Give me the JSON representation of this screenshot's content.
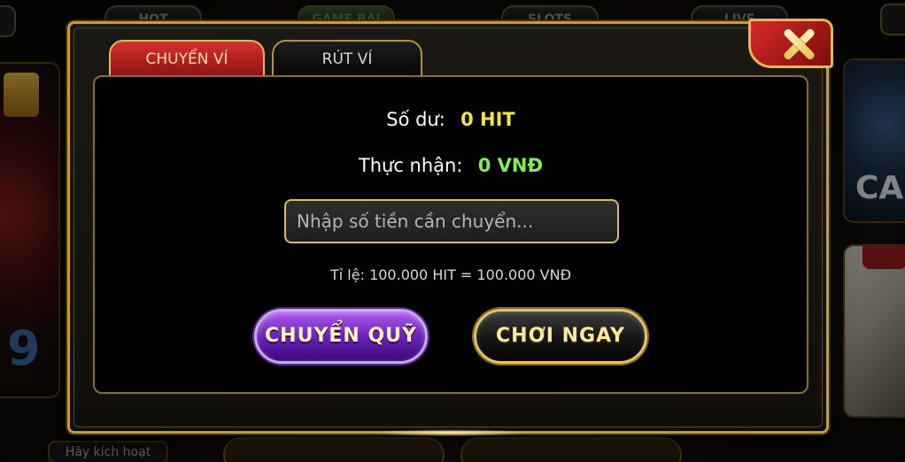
{
  "background": {
    "tabs": [
      "HOT",
      "GAME BÀI",
      "SLOTS",
      "LIVE"
    ],
    "bottom_button": "Hãy kích hoạt",
    "right_card_text": "CA",
    "left_card_number": "9"
  },
  "dialog": {
    "tabs": {
      "transfer": "CHUYỂN VÍ",
      "withdraw": "RÚT VÍ"
    },
    "balance": {
      "label": "Số dư:",
      "value": "0 HIT"
    },
    "received": {
      "label": "Thực nhận:",
      "value": "0 VNĐ"
    },
    "amount_input": {
      "placeholder": "Nhập số tiền cần chuyển...",
      "value": ""
    },
    "rate_text": "Tỉ lệ: 100.000 HIT = 100.000 VNĐ",
    "buttons": {
      "transfer": "CHUYỂN QUỸ",
      "play": "CHƠI NGAY"
    }
  },
  "colors": {
    "accent_gold": "#c79b3c",
    "balance_value": "#f2e34a",
    "received_value": "#7cf05a",
    "active_tab": "#d83030"
  },
  "icons": {
    "close": "close-icon"
  }
}
